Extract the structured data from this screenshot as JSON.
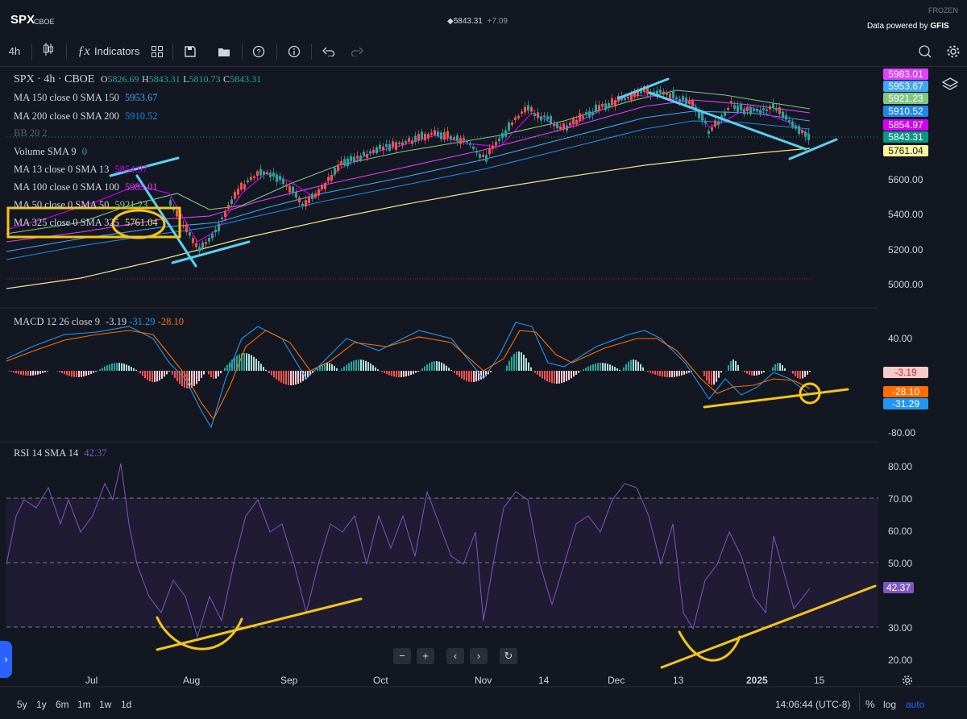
{
  "header": {
    "symbol": "SPX",
    "exchange": "CBOE",
    "quote": "5843.31",
    "change": "+7.09",
    "frozen": "FROZEN",
    "powered_by": "Data powered by",
    "provider": "GFIS"
  },
  "toolbar": {
    "interval": "4h",
    "indicators_label": "Indicators"
  },
  "legend": {
    "title": "SPX · 4h · CBOE",
    "o_label": "O",
    "o_value": "5826.69",
    "h_label": "H",
    "h_value": "5843.31",
    "l_label": "L",
    "l_value": "5810.73",
    "c_label": "C",
    "c_value": "5843.31",
    "ma150": "MA 150 close 0 SMA 150",
    "ma150_value": "5953.67",
    "ma200": "MA 200 close 0 SMA 200",
    "ma200_value": "5910.52",
    "bb": "BB 20 2",
    "volume": "Volume SMA 9",
    "volume_value": "0",
    "ma13": "MA 13 close 0 SMA 13",
    "ma13_value": "5854.97",
    "ma100": "MA 100 close 0 SMA 100",
    "ma100_value": "5983.01",
    "ma50": "MA 50 close 0 SMA 50",
    "ma50_value": "5921.23",
    "ma325": "MA 325 close 0 SMA 325",
    "ma325_value": "5761.04"
  },
  "price_tags": [
    {
      "value": "5983.01",
      "bg": "#e040fb",
      "fg": "#ffffff"
    },
    {
      "value": "5953.67",
      "bg": "#42a5f5",
      "fg": "#ffffff"
    },
    {
      "value": "5921.23",
      "bg": "#81c784",
      "fg": "#ffffff"
    },
    {
      "value": "5910.52",
      "bg": "#1e88e5",
      "fg": "#ffffff"
    },
    {
      "value": "5854.97",
      "bg": "#d500f9",
      "fg": "#ffffff"
    },
    {
      "value": "5843.31",
      "bg": "#089981",
      "fg": "#ffffff"
    },
    {
      "value": "5761.04",
      "bg": "#fff59d",
      "fg": "#131722"
    }
  ],
  "price_axis": [
    "5600.00",
    "5400.00",
    "5200.00",
    "5000.00"
  ],
  "macd": {
    "label": "MACD 12 26 close 9",
    "v1": "-3.19",
    "v2": "-31.29",
    "v3": "-28.10",
    "axis": [
      "40.00",
      "-80.00"
    ],
    "tags": [
      {
        "value": "-3.19",
        "bg": "#f7c9c9",
        "fg": "#c62828"
      },
      {
        "value": "-28.10",
        "bg": "#ff6d00",
        "fg": "#ffffff"
      },
      {
        "value": "-31.29",
        "bg": "#2196f3",
        "fg": "#ffffff"
      }
    ]
  },
  "rsi": {
    "label": "RSI 14 SMA 14",
    "value": "42.37",
    "axis": [
      "80.00",
      "70.00",
      "60.00",
      "50.00",
      "30.00",
      "20.00"
    ],
    "tag": "42.37"
  },
  "time_axis": [
    "Jul",
    "Aug",
    "Sep",
    "Oct",
    "Nov",
    "14",
    "Dec",
    "13",
    "2025",
    "15"
  ],
  "nav": {
    "minus": "−",
    "plus": "+",
    "left": "‹",
    "right": "›",
    "reset": "↻"
  },
  "ranges": [
    "5y",
    "1y",
    "6m",
    "1m",
    "1w",
    "1d"
  ],
  "footer": {
    "time": "14:06:44 (UTC-8)",
    "percent": "%",
    "log": "log",
    "auto": "auto"
  },
  "colors": {
    "up": "#26a69a",
    "down": "#ef5350",
    "annot_blue": "#5ad1f0",
    "annot_yellow": "#f5c518",
    "accent": "#2962ff"
  }
}
